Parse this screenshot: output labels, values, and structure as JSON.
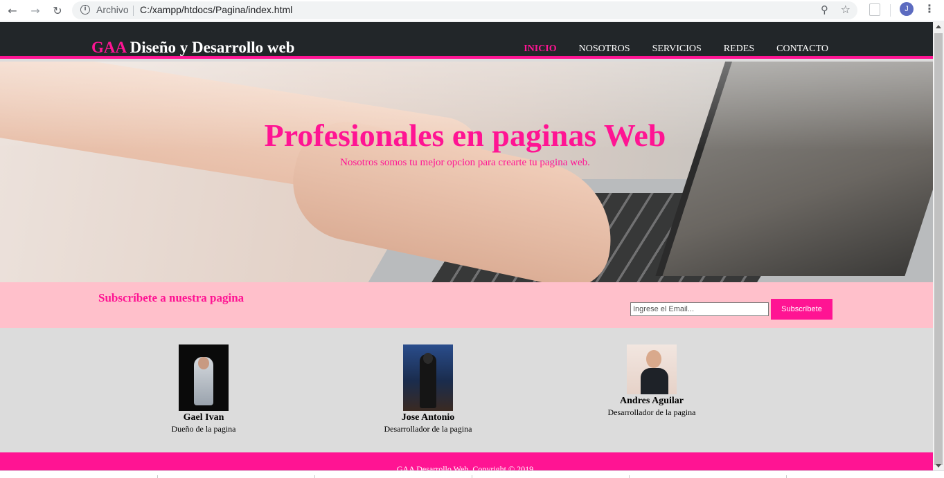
{
  "browser": {
    "security_label": "Archivo",
    "url": "C:/xampp/htdocs/Pagina/index.html",
    "profile_initial": "J",
    "icons": [
      "back-arrow-icon",
      "forward-arrow-icon",
      "reload-icon",
      "info-icon",
      "zoom-icon",
      "star-icon",
      "extension-icon",
      "menu-dots-icon"
    ]
  },
  "header": {
    "brand": "GAA",
    "title": "Diseño y Desarrollo web",
    "menu": [
      {
        "label": "INICIO",
        "active": true
      },
      {
        "label": "NOSOTROS",
        "active": false
      },
      {
        "label": "SERVICIOS",
        "active": false
      },
      {
        "label": "REDES",
        "active": false
      },
      {
        "label": "CONTACTO",
        "active": false
      }
    ]
  },
  "hero": {
    "title": "Profesionales en paginas Web",
    "subtitle": "Nosotros somos tu mejor opcion para crearte tu pagina web."
  },
  "subscribe": {
    "title": "Subscríbete a nuestra pagina",
    "email_placeholder": "Ingrese el Email...",
    "button_label": "Subscríbete"
  },
  "team": [
    {
      "name": "Gael Ivan",
      "role": "Dueño de la pagina"
    },
    {
      "name": "Jose Antonio",
      "role": "Desarrollador de la pagina"
    },
    {
      "name": "Andres Aguilar",
      "role": "Desarrollador de la pagina"
    }
  ],
  "footer": {
    "text": "GAA Desarrollo Web. Copyright © 2019"
  },
  "colors": {
    "accent": "#ff1493",
    "header_bg": "#222629",
    "subscribe_bg": "#ffc0cb",
    "team_bg": "#dcdcdc"
  }
}
